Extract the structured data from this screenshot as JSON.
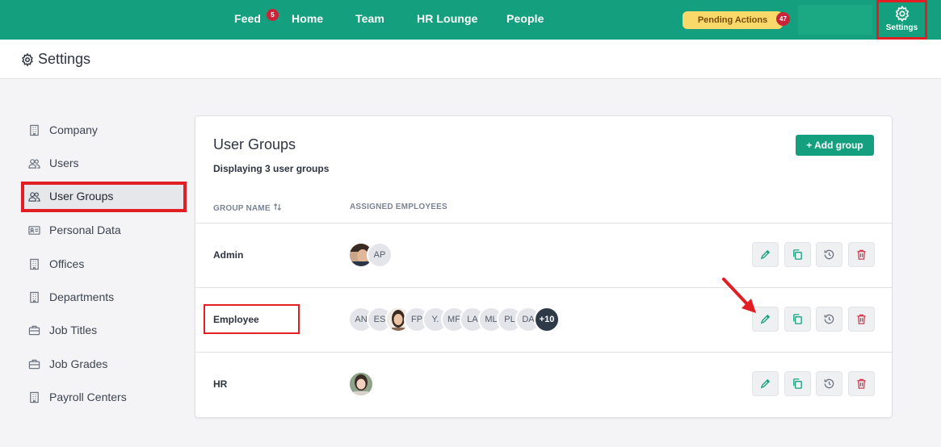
{
  "nav": {
    "items": [
      "Feed",
      "Home",
      "Team",
      "HR Lounge",
      "People"
    ],
    "feed_badge": "5",
    "pending_label": "Pending Actions",
    "pending_count": "47",
    "settings_label": "Settings"
  },
  "header": {
    "title": "Settings"
  },
  "sidebar": {
    "items": [
      {
        "label": "Company",
        "icon": "building-icon"
      },
      {
        "label": "Users",
        "icon": "users-icon"
      },
      {
        "label": "User Groups",
        "icon": "users-icon",
        "active": true
      },
      {
        "label": "Personal Data",
        "icon": "id-card-icon"
      },
      {
        "label": "Offices",
        "icon": "building-icon"
      },
      {
        "label": "Departments",
        "icon": "building-icon"
      },
      {
        "label": "Job Titles",
        "icon": "briefcase-icon"
      },
      {
        "label": "Job Grades",
        "icon": "briefcase-icon"
      },
      {
        "label": "Payroll Centers",
        "icon": "building-icon"
      }
    ]
  },
  "card": {
    "title": "User Groups",
    "subtitle": "Displaying 3 user groups",
    "add_label": "+ Add group",
    "col_name": "GROUP NAME",
    "col_employees": "ASSIGNED EMPLOYEES",
    "rows": [
      {
        "name": "Admin",
        "avatars": [
          "photo",
          "AP"
        ]
      },
      {
        "name": "Employee",
        "avatars": [
          "AN",
          "ES",
          "photo",
          "FP",
          "Y.",
          "MF",
          "LA",
          "ML",
          "PL",
          "DA",
          "+10"
        ]
      },
      {
        "name": "HR",
        "avatars": [
          "photo"
        ]
      }
    ]
  },
  "colors": {
    "brand": "#14a07e",
    "highlight": "#e01e24",
    "badge": "#c9243a",
    "pending": "#f8d96a"
  }
}
